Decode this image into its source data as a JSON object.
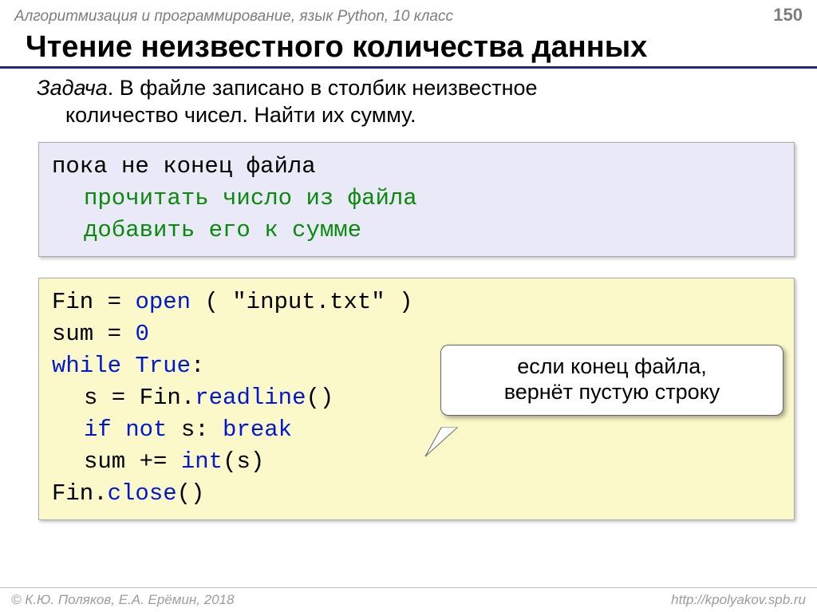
{
  "header": {
    "course": "Алгоритмизация и программирование, язык Python, 10 класс",
    "page": "150"
  },
  "title": "Чтение неизвестного количества данных",
  "task": {
    "label": "Задача",
    "line1": ". В файле записано в столбик неизвестное",
    "line2": "количество чисел. Найти их сумму."
  },
  "pseudo": {
    "l1": "пока не конец файла",
    "l2": "прочитать число из файла",
    "l3": "добавить его к сумме"
  },
  "code": {
    "l1a": "Fin",
    "l1b": " = ",
    "l1c": "open",
    "l1d": " ( ",
    "l1e": "\"input.txt\"",
    "l1f": " )",
    "l2a": "sum",
    "l2b": " = ",
    "l2c": "0",
    "l3a": "while",
    "l3b": " ",
    "l3c": "True",
    "l3d": ":",
    "l4a": "s",
    "l4b": " = ",
    "l4c": "Fin.",
    "l4d": "readline",
    "l4e": "()",
    "l5a": "if not",
    "l5b": " s: ",
    "l5c": "break",
    "l6a": "sum",
    "l6b": " += ",
    "l6c": "int",
    "l6d": "(s)",
    "l7a": "Fin.",
    "l7b": "close",
    "l7c": "()"
  },
  "callout": {
    "line1": "если конец файла,",
    "line2": "вернёт пустую строку"
  },
  "footer": {
    "left": "© К.Ю. Поляков, Е.А. Ерёмин, 2018",
    "right": "http://kpolyakov.spb.ru"
  }
}
